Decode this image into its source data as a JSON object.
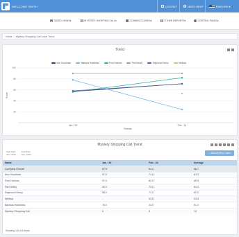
{
  "header": {
    "welcome": "WELCOME SMITH",
    "logout": "LOGOUT",
    "need_help": "NEED HELP",
    "language": "ENGLISH"
  },
  "menu": {
    "saved_views": "SAVED VIEWS",
    "mystery_calls": "MYSTERY SHOPPING CALL",
    "comment_cards": "COMMENT CARDS",
    "other_reports": "OTHER REPORTS",
    "control_panel": "CONTROL PANEL"
  },
  "breadcrumb": {
    "home": "Home",
    "divider": "/",
    "current": "Mystery Shopping Call Level Trend"
  },
  "trend_panel": {
    "title": "Trend"
  },
  "chart_data": {
    "type": "line",
    "title": "Trend",
    "categories": [
      "Jan - 24",
      "Feb - 24"
    ],
    "xlabel": "Periods",
    "ylabel": "Score",
    "ylim": [
      0,
      100
    ],
    "yticks": [
      20,
      40,
      60,
      80,
      100
    ],
    "grid": true,
    "legend": "top",
    "series": [
      {
        "name": "Ann Goodman",
        "color": "#2f3e66",
        "values": [
          57,
          71
        ]
      },
      {
        "name": "Barbara Hotchkiss",
        "color": "#75b7e6",
        "values": [
          78,
          24
        ]
      },
      {
        "name": "Fred Holmes",
        "color": "#2fb1a0",
        "values": [
          56,
          82
        ]
      },
      {
        "name": "Pat Kelsey",
        "color": "#8f9fbf",
        "values": [
          90,
          90
        ]
      },
      {
        "name": "Raymond Henry",
        "color": "#5b5fa3",
        "values": [
          58,
          71
        ]
      },
      {
        "name": "Melissa",
        "color": "#c9c47a",
        "values": [
          null,
          53
        ]
      }
    ]
  },
  "table_panel": {
    "title": "Mystery Shopping Call Trend",
    "start_label": "Start Date",
    "start_value": "Jan / 2024",
    "end_label": "End Date",
    "end_value": "Apr / 2024",
    "add_button": "Add Mystery Caller",
    "columns": [
      "Name",
      "Jan - 24",
      "Feb - 24",
      "Average"
    ],
    "rows": [
      [
        "Company Overall",
        "67.8",
        "64.2",
        "65.7"
      ],
      [
        "Ann Goodman",
        "57.0",
        "71.0",
        "64.0"
      ],
      [
        "Fred Holmes",
        "57.5",
        "82.0",
        "69.5"
      ],
      [
        "Pat Kelsey",
        "90.0",
        "73.0",
        "84.0"
      ],
      [
        "Raymond Henry",
        "58.0",
        "71.0",
        "62.0"
      ],
      [
        "Melissa",
        "-",
        "53.8",
        "53.8"
      ],
      [
        "Barbara Hotchkiss",
        "78.0",
        "24.0",
        "51.0"
      ],
      [
        "Mystery Shopping Call",
        "6",
        "8",
        "14"
      ]
    ],
    "footer": "Showing 1-8 of 8 items."
  }
}
